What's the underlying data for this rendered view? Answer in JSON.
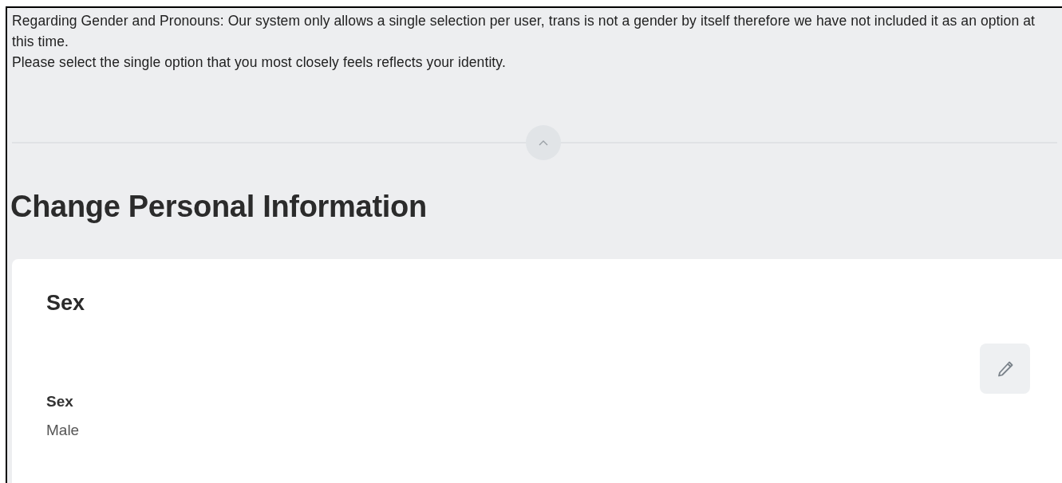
{
  "notice": {
    "paragraphs": [
      "Regarding Gender and Pronouns: Our system only allows a single selection per user, trans is not a gender by itself therefore we have not included it as an option at this time.",
      "Please select the single option that you most closely feels reflects your identity."
    ],
    "collapse_button": {
      "expanded": true
    }
  },
  "page_title": "Change Personal Information",
  "card": {
    "title": "Sex",
    "fields": [
      {
        "label": "Sex",
        "value": "Male",
        "editable": true
      }
    ]
  }
}
